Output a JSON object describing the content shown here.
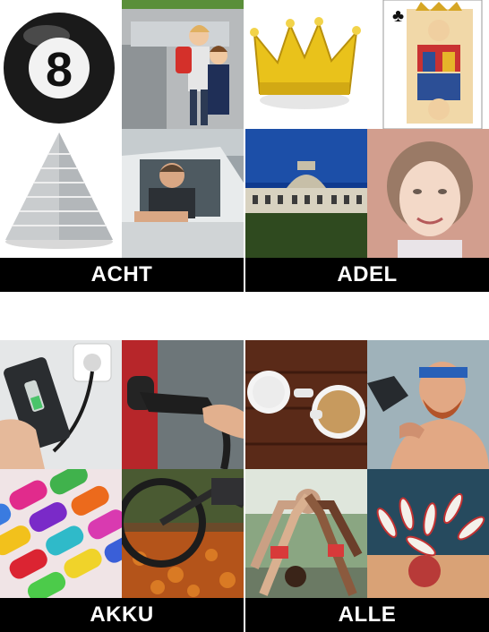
{
  "puzzles": [
    {
      "answer": "ACHT",
      "images": [
        "billiard-8-ball-icon",
        "children-with-backpacks-by-car-icon",
        "pyramid-cone-icon",
        "man-leaning-out-of-car-window-icon"
      ]
    },
    {
      "answer": "ADEL",
      "images": [
        "gold-crown-icon",
        "king-of-clubs-card-icon",
        "palace-building-icon",
        "queen-on-banknote-icon"
      ]
    },
    {
      "answer": "AKKU",
      "images": [
        "smartphone-charging-icon",
        "ev-charging-plug-icon",
        "colorful-batteries-icon",
        "e-bike-in-autumn-leaves-icon"
      ]
    },
    {
      "answer": "ALLE",
      "images": [
        "coffee-cups-top-view-icon",
        "man-with-headband-and-dryer-icon",
        "group-high-five-icon",
        "bowling-pins-strike-icon"
      ]
    }
  ]
}
